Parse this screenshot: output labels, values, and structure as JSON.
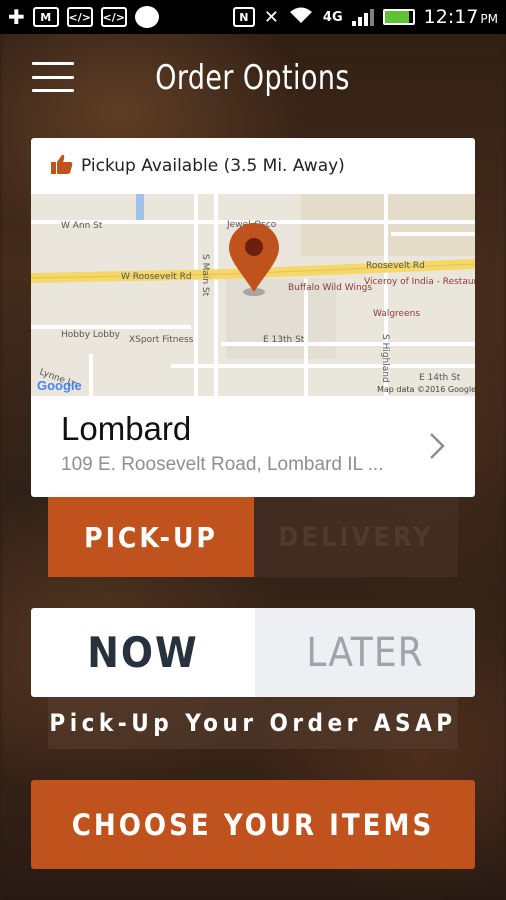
{
  "status_bar": {
    "time": "12:17",
    "ampm": "PM",
    "network": "4G"
  },
  "header": {
    "title": "Order Options"
  },
  "location": {
    "availability": "Pickup Available (3.5 Mi. Away)",
    "name": "Lombard",
    "address": "109 E. Roosevelt Road, Lombard IL ..."
  },
  "map": {
    "streets": [
      "W Ann St",
      "W Roosevelt Rd",
      "Roosevelt Rd",
      "S Main St",
      "E 13th St",
      "S Highland",
      "Lynne Ln",
      "E 14th St"
    ],
    "places": [
      "Jewel-Osco",
      "Buffalo Wild Wings",
      "Viceroy of India - Restaurant",
      "Walgreens",
      "Hobby Lobby",
      "XSport Fitness"
    ],
    "google": "Google",
    "attribution": "Map data ©2016 Google"
  },
  "fulfillment": {
    "pickup_label": "PICK-UP",
    "delivery_label": "DELIVERY"
  },
  "timing": {
    "now_label": "NOW",
    "later_label": "LATER",
    "note": "Pick-Up Your Order ASAP"
  },
  "cta_label": "CHOOSE YOUR ITEMS",
  "colors": {
    "accent": "#c0521e",
    "pin": "#c0521e",
    "thumb": "#c0521e"
  }
}
